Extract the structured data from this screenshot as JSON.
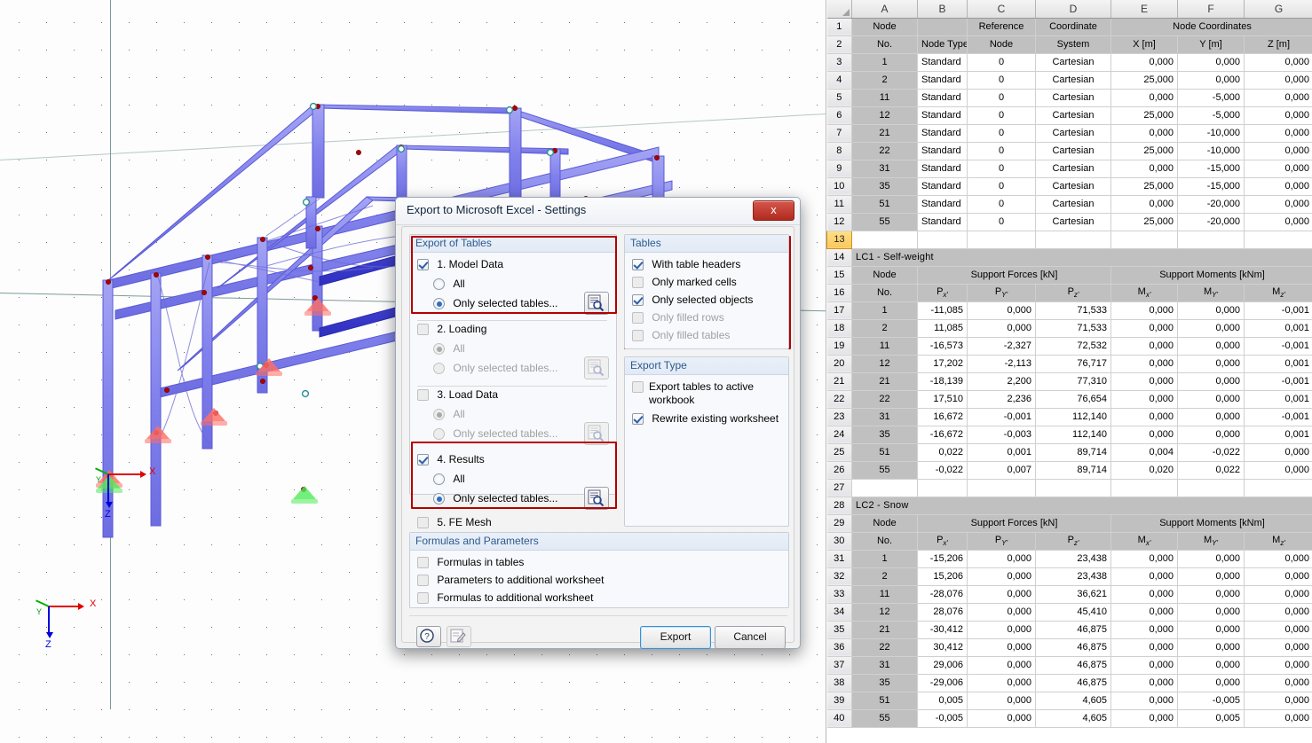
{
  "dialog": {
    "title": "Export to Microsoft Excel - Settings",
    "close_label": "x",
    "groups": {
      "export_of_tables": {
        "title": "Export of Tables",
        "items": [
          {
            "label": "1. Model Data",
            "checked": true,
            "options": [
              {
                "label": "All",
                "selected": false
              },
              {
                "label": "Only selected tables...",
                "selected": true
              }
            ]
          },
          {
            "label": "2. Loading",
            "checked": false,
            "options": [
              {
                "label": "All",
                "selected": true
              },
              {
                "label": "Only selected tables...",
                "selected": false
              }
            ]
          },
          {
            "label": "3. Load Data",
            "checked": false,
            "options": [
              {
                "label": "All",
                "selected": true
              },
              {
                "label": "Only selected tables...",
                "selected": false
              }
            ]
          },
          {
            "label": "4. Results",
            "checked": true,
            "options": [
              {
                "label": "All",
                "selected": false
              },
              {
                "label": "Only selected tables...",
                "selected": true
              }
            ]
          },
          {
            "label": "5. FE Mesh",
            "checked": false,
            "options": []
          }
        ]
      },
      "tables": {
        "title": "Tables",
        "items": [
          {
            "label": "With table headers",
            "checked": true,
            "disabled": false
          },
          {
            "label": "Only marked cells",
            "checked": false,
            "disabled": false
          },
          {
            "label": "Only selected objects",
            "checked": true,
            "disabled": false
          },
          {
            "label": "Only filled rows",
            "checked": false,
            "disabled": true
          },
          {
            "label": "Only filled tables",
            "checked": false,
            "disabled": true
          }
        ]
      },
      "export_type": {
        "title": "Export Type",
        "items": [
          {
            "label": "Export tables to active workbook",
            "checked": false,
            "disabled": false
          },
          {
            "label": "Rewrite existing worksheet",
            "checked": true,
            "disabled": false
          }
        ]
      },
      "formulas_and_parameters": {
        "title": "Formulas and Parameters",
        "items": [
          {
            "label": "Formulas in tables",
            "checked": false
          },
          {
            "label": "Parameters to additional worksheet",
            "checked": false
          },
          {
            "label": "Formulas to additional worksheet",
            "checked": false
          }
        ]
      }
    },
    "buttons": {
      "export": "Export",
      "cancel": "Cancel",
      "help_icon": "question-mark-icon",
      "notes_icon": "edit-note-icon",
      "table_picker_icon": "table-magnifier-icon"
    }
  },
  "viewport": {
    "axis_labels": {
      "x": "X",
      "y": "Y",
      "z": "Z"
    },
    "colors": {
      "member": "#8a8aee",
      "member_dark": "#3a3ad0",
      "node": "#b00000",
      "support_fixed": "#ff6e64",
      "support_free": "#50eb5a",
      "axis_x": "#e00000",
      "axis_y": "#00c000",
      "axis_z": "#0000dd"
    }
  },
  "excel": {
    "columns": [
      "A",
      "B",
      "C",
      "D",
      "E",
      "F",
      "G"
    ],
    "active_row": 13,
    "sections": [
      {
        "kind": "node-coordinates",
        "header_rows": [
          {
            "row": 1,
            "cells": [
              "Node",
              "",
              "Reference",
              "Coordinate",
              "Node Coordinates",
              "",
              ""
            ]
          },
          {
            "row": 2,
            "cells": [
              "No.",
              "Node Type",
              "Node",
              "System",
              "X [m]",
              "Y [m]",
              "Z [m]"
            ]
          }
        ],
        "rows": [
          {
            "row": 3,
            "cells": [
              "1",
              "Standard",
              "0",
              "Cartesian",
              "0,000",
              "0,000",
              "0,000"
            ]
          },
          {
            "row": 4,
            "cells": [
              "2",
              "Standard",
              "0",
              "Cartesian",
              "25,000",
              "0,000",
              "0,000"
            ]
          },
          {
            "row": 5,
            "cells": [
              "11",
              "Standard",
              "0",
              "Cartesian",
              "0,000",
              "-5,000",
              "0,000"
            ]
          },
          {
            "row": 6,
            "cells": [
              "12",
              "Standard",
              "0",
              "Cartesian",
              "25,000",
              "-5,000",
              "0,000"
            ]
          },
          {
            "row": 7,
            "cells": [
              "21",
              "Standard",
              "0",
              "Cartesian",
              "0,000",
              "-10,000",
              "0,000"
            ]
          },
          {
            "row": 8,
            "cells": [
              "22",
              "Standard",
              "0",
              "Cartesian",
              "25,000",
              "-10,000",
              "0,000"
            ]
          },
          {
            "row": 9,
            "cells": [
              "31",
              "Standard",
              "0",
              "Cartesian",
              "0,000",
              "-15,000",
              "0,000"
            ]
          },
          {
            "row": 10,
            "cells": [
              "35",
              "Standard",
              "0",
              "Cartesian",
              "25,000",
              "-15,000",
              "0,000"
            ]
          },
          {
            "row": 11,
            "cells": [
              "51",
              "Standard",
              "0",
              "Cartesian",
              "0,000",
              "-20,000",
              "0,000"
            ]
          },
          {
            "row": 12,
            "cells": [
              "55",
              "Standard",
              "0",
              "Cartesian",
              "25,000",
              "-20,000",
              "0,000"
            ]
          }
        ],
        "blank_row": 13
      },
      {
        "kind": "support-reactions",
        "title_row": {
          "row": 14,
          "title": "LC1 - Self-weight"
        },
        "header_rows": [
          {
            "row": 15,
            "cells": [
              "Node",
              "Support Forces [kN]",
              "",
              "",
              "Support Moments [kNm]",
              "",
              ""
            ]
          },
          {
            "row": 16,
            "cells": [
              "No.",
              "Px'",
              "PY'",
              "Pz'",
              "Mx'",
              "MY'",
              "Mz'"
            ]
          }
        ],
        "rows": [
          {
            "row": 17,
            "cells": [
              "1",
              "-11,085",
              "0,000",
              "71,533",
              "0,000",
              "0,000",
              "-0,001"
            ]
          },
          {
            "row": 18,
            "cells": [
              "2",
              "11,085",
              "0,000",
              "71,533",
              "0,000",
              "0,000",
              "0,001"
            ]
          },
          {
            "row": 19,
            "cells": [
              "11",
              "-16,573",
              "-2,327",
              "72,532",
              "0,000",
              "0,000",
              "-0,001"
            ]
          },
          {
            "row": 20,
            "cells": [
              "12",
              "17,202",
              "-2,113",
              "76,717",
              "0,000",
              "0,000",
              "0,001"
            ]
          },
          {
            "row": 21,
            "cells": [
              "21",
              "-18,139",
              "2,200",
              "77,310",
              "0,000",
              "0,000",
              "-0,001"
            ]
          },
          {
            "row": 22,
            "cells": [
              "22",
              "17,510",
              "2,236",
              "76,654",
              "0,000",
              "0,000",
              "0,001"
            ]
          },
          {
            "row": 23,
            "cells": [
              "31",
              "16,672",
              "-0,001",
              "112,140",
              "0,000",
              "0,000",
              "-0,001"
            ]
          },
          {
            "row": 24,
            "cells": [
              "35",
              "-16,672",
              "-0,003",
              "112,140",
              "0,000",
              "0,000",
              "0,001"
            ]
          },
          {
            "row": 25,
            "cells": [
              "51",
              "0,022",
              "0,001",
              "89,714",
              "0,004",
              "-0,022",
              "0,000"
            ]
          },
          {
            "row": 26,
            "cells": [
              "55",
              "-0,022",
              "0,007",
              "89,714",
              "0,020",
              "0,022",
              "0,000"
            ]
          }
        ],
        "blank_row": 27
      },
      {
        "kind": "support-reactions",
        "title_row": {
          "row": 28,
          "title": "LC2 - Snow"
        },
        "header_rows": [
          {
            "row": 29,
            "cells": [
              "Node",
              "Support Forces [kN]",
              "",
              "",
              "Support Moments [kNm]",
              "",
              ""
            ]
          },
          {
            "row": 30,
            "cells": [
              "No.",
              "Px'",
              "PY'",
              "Pz'",
              "Mx'",
              "MY'",
              "Mz'"
            ]
          }
        ],
        "rows": [
          {
            "row": 31,
            "cells": [
              "1",
              "-15,206",
              "0,000",
              "23,438",
              "0,000",
              "0,000",
              "0,000"
            ]
          },
          {
            "row": 32,
            "cells": [
              "2",
              "15,206",
              "0,000",
              "23,438",
              "0,000",
              "0,000",
              "0,000"
            ]
          },
          {
            "row": 33,
            "cells": [
              "11",
              "-28,076",
              "0,000",
              "36,621",
              "0,000",
              "0,000",
              "0,000"
            ]
          },
          {
            "row": 34,
            "cells": [
              "12",
              "28,076",
              "0,000",
              "45,410",
              "0,000",
              "0,000",
              "0,000"
            ]
          },
          {
            "row": 35,
            "cells": [
              "21",
              "-30,412",
              "0,000",
              "46,875",
              "0,000",
              "0,000",
              "0,000"
            ]
          },
          {
            "row": 36,
            "cells": [
              "22",
              "30,412",
              "0,000",
              "46,875",
              "0,000",
              "0,000",
              "0,000"
            ]
          },
          {
            "row": 37,
            "cells": [
              "31",
              "29,006",
              "0,000",
              "46,875",
              "0,000",
              "0,000",
              "0,000"
            ]
          },
          {
            "row": 38,
            "cells": [
              "35",
              "-29,006",
              "0,000",
              "46,875",
              "0,000",
              "0,000",
              "0,000"
            ]
          },
          {
            "row": 39,
            "cells": [
              "51",
              "0,005",
              "0,000",
              "4,605",
              "0,000",
              "-0,005",
              "0,000"
            ]
          },
          {
            "row": 40,
            "cells": [
              "55",
              "-0,005",
              "0,000",
              "4,605",
              "0,000",
              "0,005",
              "0,000"
            ]
          }
        ],
        "blank_row": null
      }
    ]
  }
}
